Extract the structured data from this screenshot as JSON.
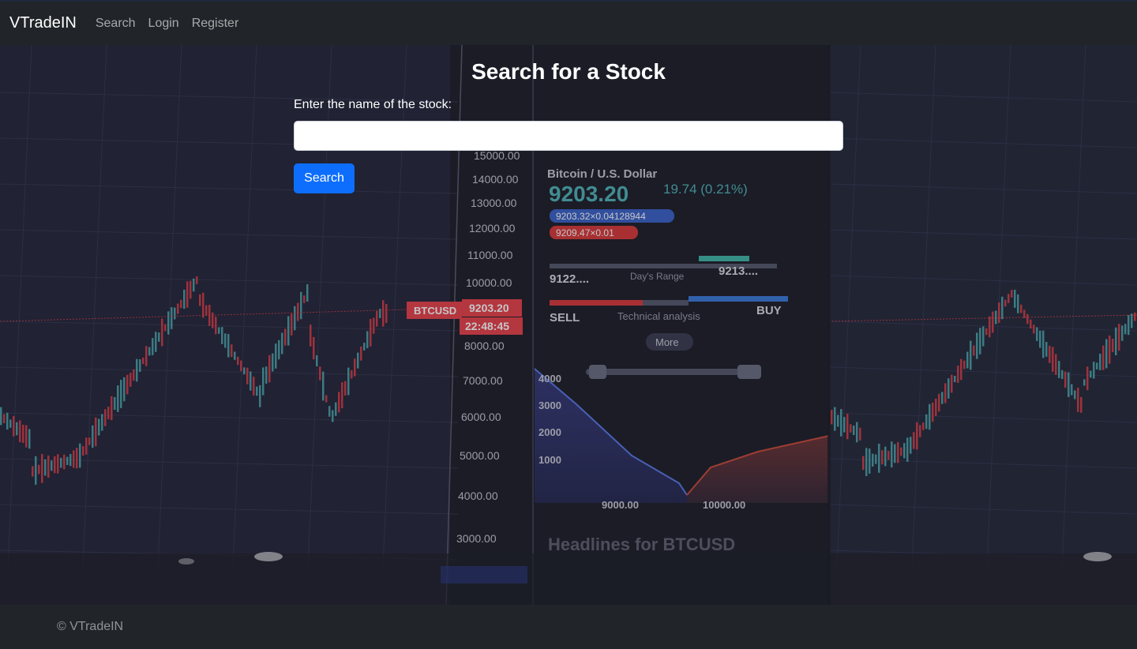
{
  "navbar": {
    "brand": "VTradeIN",
    "links": [
      {
        "label": "Search"
      },
      {
        "label": "Login"
      },
      {
        "label": "Register"
      }
    ]
  },
  "main": {
    "title": "Search for a Stock",
    "field_label": "Enter the name of the stock:",
    "input_value": "",
    "submit_label": "Search"
  },
  "background": {
    "pair_label": "BTCUSD",
    "price_tag": "9203.20",
    "time_tag": "22:48:45",
    "asset_name": "Bitcoin / U.S. Dollar",
    "price": "9203.20",
    "change": "19.74 (0.21%)",
    "bid": "9203.32×0.04128944",
    "ask": "9209.47×0.01",
    "range_low": "9122....",
    "range_label": "Day's Range",
    "range_high": "9213....",
    "sell_label": "SELL",
    "tech_label": "Technical analysis",
    "buy_label": "BUY",
    "more_label": "More",
    "y_ticks": [
      "15000.00",
      "14000.00",
      "13000.00",
      "12000.00",
      "11000.00",
      "10000.00",
      "8000.00",
      "7000.00",
      "6000.00",
      "5000.00",
      "4000.00",
      "3000.00"
    ],
    "depth_ticks": [
      "4000",
      "3000",
      "2000",
      "1000"
    ],
    "depth_x": [
      "9000.00",
      "10000.00"
    ],
    "headline": "Headlines for BTCUSD"
  },
  "footer": {
    "copyright": "© VTradeIN"
  },
  "colors": {
    "navbar_bg": "#212529",
    "primary": "#0d6efd",
    "candle_up": "#4fb3b8",
    "candle_down": "#e8404a"
  }
}
